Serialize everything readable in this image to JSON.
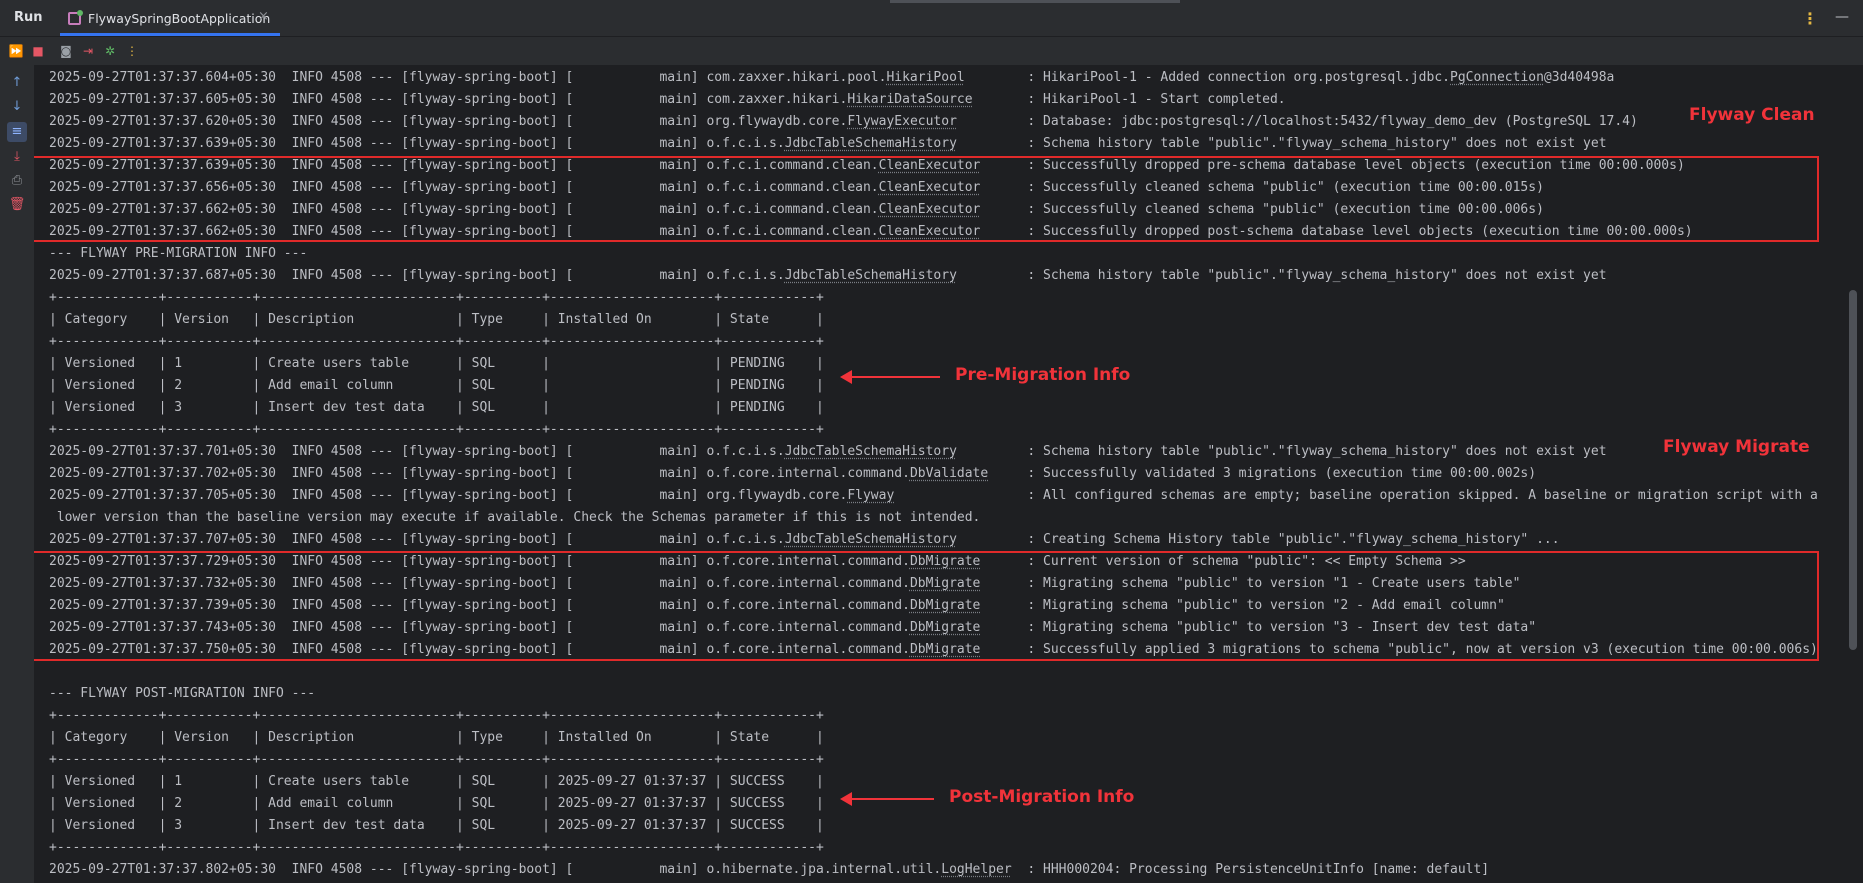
{
  "window": {
    "run_label": "Run",
    "tab_title": "FlywaySpringBootApplication",
    "close_glyph": "×",
    "kebab_glyph": "⋮",
    "minimize_glyph": "—"
  },
  "toolbar": [
    {
      "name": "rerun-icon",
      "glyph": "⏩",
      "color": "#5fb865"
    },
    {
      "name": "stop-icon",
      "glyph": "■",
      "color": "#e55765"
    },
    {
      "name": "camera-icon",
      "glyph": "◙",
      "color": "#9aa0a6"
    },
    {
      "name": "exit-icon",
      "glyph": "⇥",
      "color": "#e55765"
    },
    {
      "name": "debug-icon",
      "glyph": "✲",
      "color": "#5fb865"
    },
    {
      "name": "more-icon",
      "glyph": "⋮",
      "color": "#e5b843"
    }
  ],
  "gutter": [
    {
      "name": "scroll-up-icon",
      "glyph": "↑"
    },
    {
      "name": "scroll-down-icon",
      "glyph": "↓"
    },
    {
      "name": "soft-wrap-icon",
      "glyph": "≡"
    },
    {
      "name": "scroll-to-end-icon",
      "glyph": "⤓"
    },
    {
      "name": "print-icon",
      "glyph": "⎙"
    },
    {
      "name": "clear-all-icon",
      "glyph": "🗑"
    }
  ],
  "log_lines": [
    {
      "pre": "2025-09-27T01:37:37.604+05:30  INFO 4508 --- [flyway-spring-boot] [           main] com.zaxxer.hikari.pool.",
      "u": "HikariPool",
      "post": "        : HikariPool-1 - Added connection org.postgresql.jdbc.",
      "u2": "PgConnection",
      "post2": "@3d40498a"
    },
    {
      "pre": "2025-09-27T01:37:37.605+05:30  INFO 4508 --- [flyway-spring-boot] [           main] com.zaxxer.hikari.",
      "u": "HikariDataSource",
      "post": "       : HikariPool-1 - Start completed."
    },
    {
      "pre": "2025-09-27T01:37:37.620+05:30  INFO 4508 --- [flyway-spring-boot] [           main] org.flywaydb.core.",
      "u": "FlywayExecutor",
      "post": "         : Database: jdbc:postgresql://localhost:5432/flyway_demo_dev (PostgreSQL 17.4)"
    },
    {
      "pre": "2025-09-27T01:37:37.639+05:30  INFO 4508 --- [flyway-spring-boot] [           main] o.f.c.i.s.",
      "u": "JdbcTableSchemaHistory",
      "post": "         : Schema history table \"public\".\"flyway_schema_history\" does not exist yet"
    },
    {
      "pre": "2025-09-27T01:37:37.639+05:30  INFO 4508 --- [flyway-spring-boot] [           main] o.f.c.i.command.clean.",
      "u": "CleanExecutor",
      "post": "      : Successfully dropped pre-schema database level objects (execution time 00:00.000s)"
    },
    {
      "pre": "2025-09-27T01:37:37.656+05:30  INFO 4508 --- [flyway-spring-boot] [           main] o.f.c.i.command.clean.",
      "u": "CleanExecutor",
      "post": "      : Successfully cleaned schema \"public\" (execution time 00:00.015s)"
    },
    {
      "pre": "2025-09-27T01:37:37.662+05:30  INFO 4508 --- [flyway-spring-boot] [           main] o.f.c.i.command.clean.",
      "u": "CleanExecutor",
      "post": "      : Successfully cleaned schema \"public\" (execution time 00:00.006s)"
    },
    {
      "pre": "2025-09-27T01:37:37.662+05:30  INFO 4508 --- [flyway-spring-boot] [           main] o.f.c.i.command.clean.",
      "u": "CleanExecutor",
      "post": "      : Successfully dropped post-schema database level objects (execution time 00:00.000s)"
    },
    {
      "pre": "--- FLYWAY PRE-MIGRATION INFO ---"
    },
    {
      "pre": "2025-09-27T01:37:37.687+05:30  INFO 4508 --- [flyway-spring-boot] [           main] o.f.c.i.s.",
      "u": "JdbcTableSchemaHistory",
      "post": "         : Schema history table \"public\".\"flyway_schema_history\" does not exist yet"
    },
    {
      "pre": "+-------------+-----------+-------------------------+----------+---------------------+------------+"
    },
    {
      "pre": "| Category    | Version   | Description             | Type     | Installed On        | State      |"
    },
    {
      "pre": "+-------------+-----------+-------------------------+----------+---------------------+------------+"
    },
    {
      "pre": "| Versioned   | 1         | Create users table      | SQL      |                     | PENDING    |"
    },
    {
      "pre": "| Versioned   | 2         | Add email column        | SQL      |                     | PENDING    |"
    },
    {
      "pre": "| Versioned   | 3         | Insert dev test data    | SQL      |                     | PENDING    |"
    },
    {
      "pre": "+-------------+-----------+-------------------------+----------+---------------------+------------+"
    },
    {
      "pre": "2025-09-27T01:37:37.701+05:30  INFO 4508 --- [flyway-spring-boot] [           main] o.f.c.i.s.",
      "u": "JdbcTableSchemaHistory",
      "post": "         : Schema history table \"public\".\"flyway_schema_history\" does not exist yet"
    },
    {
      "pre": "2025-09-27T01:37:37.702+05:30  INFO 4508 --- [flyway-spring-boot] [           main] o.f.core.internal.command.",
      "u": "DbValidate",
      "post": "     : Successfully validated 3 migrations (execution time 00:00.002s)"
    },
    {
      "pre": "2025-09-27T01:37:37.705+05:30  INFO 4508 --- [flyway-spring-boot] [           main] org.flywaydb.core.",
      "u": "Flyway",
      "post": "                 : All configured schemas are empty; baseline operation skipped. A baseline or migration script with a"
    },
    {
      "pre": " lower version than the baseline version may execute if available. Check the Schemas parameter if this is not intended."
    },
    {
      "pre": "2025-09-27T01:37:37.707+05:30  INFO 4508 --- [flyway-spring-boot] [           main] o.f.c.i.s.",
      "u": "JdbcTableSchemaHistory",
      "post": "         : Creating Schema History table \"public\".\"flyway_schema_history\" ..."
    },
    {
      "pre": "2025-09-27T01:37:37.729+05:30  INFO 4508 --- [flyway-spring-boot] [           main] o.f.core.internal.command.",
      "u": "DbMigrate",
      "post": "      : Current version of schema \"public\": << Empty Schema >>"
    },
    {
      "pre": "2025-09-27T01:37:37.732+05:30  INFO 4508 --- [flyway-spring-boot] [           main] o.f.core.internal.command.",
      "u": "DbMigrate",
      "post": "      : Migrating schema \"public\" to version \"1 - Create users table\""
    },
    {
      "pre": "2025-09-27T01:37:37.739+05:30  INFO 4508 --- [flyway-spring-boot] [           main] o.f.core.internal.command.",
      "u": "DbMigrate",
      "post": "      : Migrating schema \"public\" to version \"2 - Add email column\""
    },
    {
      "pre": "2025-09-27T01:37:37.743+05:30  INFO 4508 --- [flyway-spring-boot] [           main] o.f.core.internal.command.",
      "u": "DbMigrate",
      "post": "      : Migrating schema \"public\" to version \"3 - Insert dev test data\""
    },
    {
      "pre": "2025-09-27T01:37:37.750+05:30  INFO 4508 --- [flyway-spring-boot] [           main] o.f.core.internal.command.",
      "u": "DbMigrate",
      "post": "      : Successfully applied 3 migrations to schema \"public\", now at version v3 (execution time 00:00.006s)"
    },
    {
      "pre": ""
    },
    {
      "pre": "--- FLYWAY POST-MIGRATION INFO ---"
    },
    {
      "pre": "+-------------+-----------+-------------------------+----------+---------------------+------------+"
    },
    {
      "pre": "| Category    | Version   | Description             | Type     | Installed On        | State      |"
    },
    {
      "pre": "+-------------+-----------+-------------------------+----------+---------------------+------------+"
    },
    {
      "pre": "| Versioned   | 1         | Create users table      | SQL      | 2025-09-27 01:37:37 | SUCCESS    |"
    },
    {
      "pre": "| Versioned   | 2         | Add email column        | SQL      | 2025-09-27 01:37:37 | SUCCESS    |"
    },
    {
      "pre": "| Versioned   | 3         | Insert dev test data    | SQL      | 2025-09-27 01:37:37 | SUCCESS    |"
    },
    {
      "pre": "+-------------+-----------+-------------------------+----------+---------------------+------------+"
    },
    {
      "pre": "2025-09-27T01:37:37.802+05:30  INFO 4508 --- [flyway-spring-boot] [           main] o.hibernate.jpa.internal.util.",
      "u": "LogHelper",
      "post": "  : HHH000204: Processing PersistenceUnitInfo [name: default]"
    }
  ],
  "annotations": {
    "flyway_clean": "Flyway Clean",
    "pre_migration": "Pre-Migration Info",
    "flyway_migrate": "Flyway Migrate",
    "post_migration": "Post-Migration Info"
  },
  "colors": {
    "highlight": "#e02a2a",
    "annotation": "#f1333a",
    "accent": "#3574f0"
  }
}
